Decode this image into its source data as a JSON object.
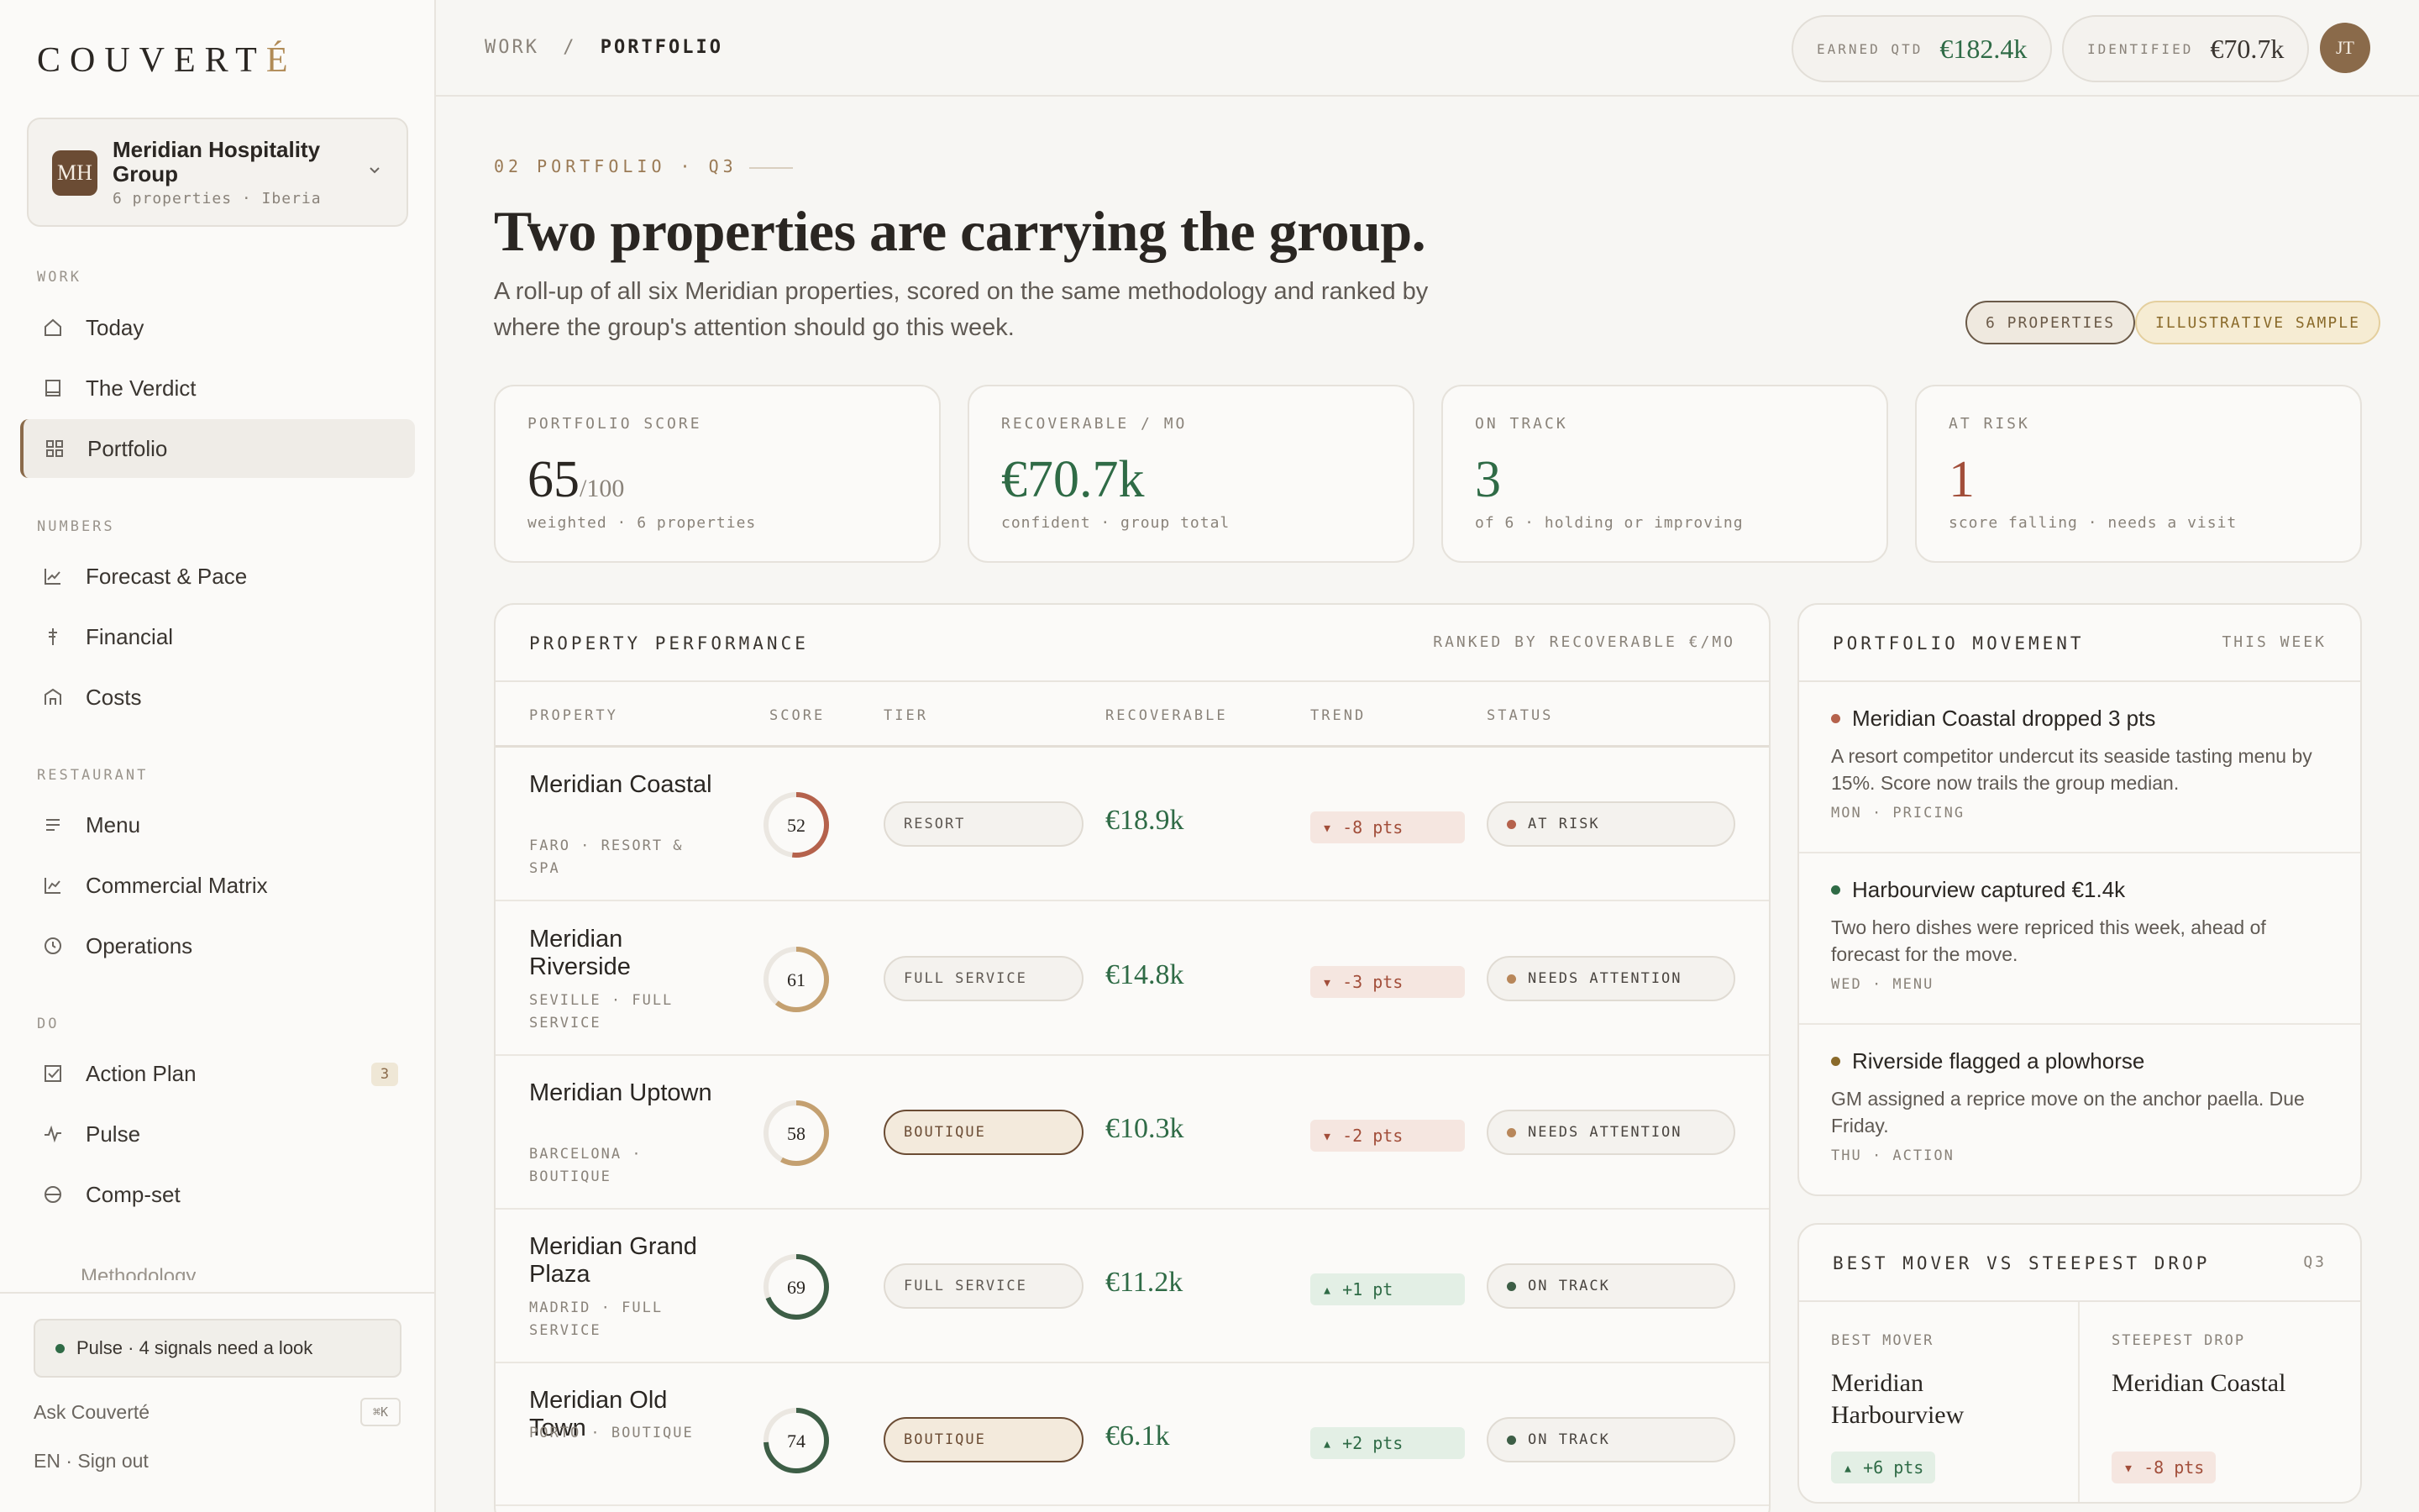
{
  "brand": {
    "name_main": "COUVERT",
    "name_accent": "É"
  },
  "org": {
    "initials": "MH",
    "name": "Meridian Hospitality Group",
    "meta": "6 properties · Iberia"
  },
  "nav": {
    "sections": {
      "work": "WORK",
      "numbers": "NUMBERS",
      "restaurant": "RESTAURANT",
      "do": "DO"
    },
    "items": [
      {
        "label": "Today",
        "icon": "home-icon"
      },
      {
        "label": "The Verdict",
        "icon": "document-icon"
      },
      {
        "label": "Portfolio",
        "icon": "grid-icon",
        "active": true
      },
      {
        "label": "Forecast & Pace",
        "icon": "line-chart-icon"
      },
      {
        "label": "Financial",
        "icon": "currency-icon"
      },
      {
        "label": "Costs",
        "icon": "building-icon"
      },
      {
        "label": "Menu",
        "icon": "list-icon"
      },
      {
        "label": "Commercial Matrix",
        "icon": "chart-icon"
      },
      {
        "label": "Operations",
        "icon": "clock-icon"
      },
      {
        "label": "Action Plan",
        "icon": "checkbox-icon",
        "badge": "3"
      },
      {
        "label": "Pulse",
        "icon": "pulse-icon"
      },
      {
        "label": "Comp-set",
        "icon": "compare-icon"
      }
    ],
    "partial": "Methodology"
  },
  "footer": {
    "pulse": "Pulse · 4 signals need a look",
    "ask": "Ask Couverté",
    "shortcut": "⌘K",
    "signout": "EN · Sign out"
  },
  "topbar": {
    "crumb_parent": "WORK",
    "crumb_sep": "/",
    "crumb_current": "PORTFOLIO",
    "earned_label": "EARNED QTD",
    "earned_value": "€182.4k",
    "identified_label": "IDENTIFIED",
    "identified_value": "€70.7k",
    "user_initials": "JT"
  },
  "header": {
    "eyebrow": "02 PORTFOLIO · Q3",
    "title": "Two properties are carrying the group.",
    "subtitle": "A roll-up of all six Meridian properties, scored on the same methodology and ranked by where the group's attention should go this week.",
    "tag_properties": "6 PROPERTIES",
    "tag_sample": "ILLUSTRATIVE SAMPLE"
  },
  "kpis": [
    {
      "label": "PORTFOLIO SCORE",
      "value": "65",
      "unit": "/100",
      "foot": "weighted · 6 properties",
      "color": "#2a2622"
    },
    {
      "label": "RECOVERABLE / MO",
      "value": "€70.7k",
      "unit": "",
      "foot": "confident · group total",
      "color": "#2f6b46"
    },
    {
      "label": "ON TRACK",
      "value": "3",
      "unit": "",
      "foot": "of 6 · holding or improving",
      "color": "#2f6b46"
    },
    {
      "label": "AT RISK",
      "value": "1",
      "unit": "",
      "foot": "score falling · needs a visit",
      "color": "#a24e3a"
    }
  ],
  "table": {
    "title": "PROPERTY PERFORMANCE",
    "sort_note": "RANKED BY RECOVERABLE €/MO",
    "columns": [
      "PROPERTY",
      "SCORE",
      "TIER",
      "RECOVERABLE",
      "TREND",
      "STATUS"
    ],
    "rows": [
      {
        "name": "Meridian Coastal",
        "meta": "FARO · RESORT & SPA",
        "score": 52,
        "tier": "RESORT",
        "boutique": false,
        "recoverable": "€18.9k",
        "trend": "▾ -8 pts",
        "trend_dir": "down",
        "status": "AT RISK",
        "status_color": "#b5624c",
        "ring_color": "#b5624c"
      },
      {
        "name": "Meridian Riverside",
        "meta": "SEVILLE · FULL SERVICE",
        "score": 61,
        "tier": "FULL SERVICE",
        "boutique": false,
        "recoverable": "€14.8k",
        "trend": "▾ -3 pts",
        "trend_dir": "down",
        "status": "NEEDS ATTENTION",
        "status_color": "#b8875a",
        "ring_color": "#c4a070"
      },
      {
        "name": "Meridian Uptown",
        "meta": "BARCELONA · BOUTIQUE",
        "score": 58,
        "tier": "BOUTIQUE",
        "boutique": true,
        "recoverable": "€10.3k",
        "trend": "▾ -2 pts",
        "trend_dir": "down",
        "status": "NEEDS ATTENTION",
        "status_color": "#b8875a",
        "ring_color": "#c4a070"
      },
      {
        "name": "Meridian Grand Plaza",
        "meta": "MADRID · FULL SERVICE",
        "score": 69,
        "tier": "FULL SERVICE",
        "boutique": false,
        "recoverable": "€11.2k",
        "trend": "▴ +1 pt",
        "trend_dir": "up",
        "status": "ON TRACK",
        "status_color": "#3d5e46",
        "ring_color": "#3d5e46"
      },
      {
        "name": "Meridian Old Town",
        "meta": "PORTO · BOUTIQUE",
        "score": 74,
        "tier": "BOUTIQUE",
        "boutique": true,
        "recoverable": "€6.1k",
        "trend": "▴ +2 pts",
        "trend_dir": "up",
        "status": "ON TRACK",
        "status_color": "#3d5e46",
        "ring_color": "#3d5e46"
      }
    ]
  },
  "movement": {
    "title": "PORTFOLIO MOVEMENT",
    "period": "THIS WEEK",
    "items": [
      {
        "title": "Meridian Coastal dropped 3 pts",
        "body": "A resort competitor undercut its seaside tasting menu by 15%. Score now trails the group median.",
        "meta": "MON · PRICING",
        "dot": "#b5624c"
      },
      {
        "title": "Harbourview captured €1.4k",
        "body": "Two hero dishes were repriced this week, ahead of forecast for the move.",
        "meta": "WED · MENU",
        "dot": "#2f6b46"
      },
      {
        "title": "Riverside flagged a plowhorse",
        "body": "GM assigned a reprice move on the anchor paella. Due Friday.",
        "meta": "THU · ACTION",
        "dot": "#8a6a2a"
      }
    ]
  },
  "movers": {
    "title": "BEST MOVER VS STEEPEST DROP",
    "period": "Q3",
    "best_label": "BEST MOVER",
    "best_name": "Meridian Harbourview",
    "best_delta": "▴ +6 pts",
    "drop_label": "STEEPEST DROP",
    "drop_name": "Meridian Coastal",
    "drop_delta": "▾ -8 pts"
  }
}
